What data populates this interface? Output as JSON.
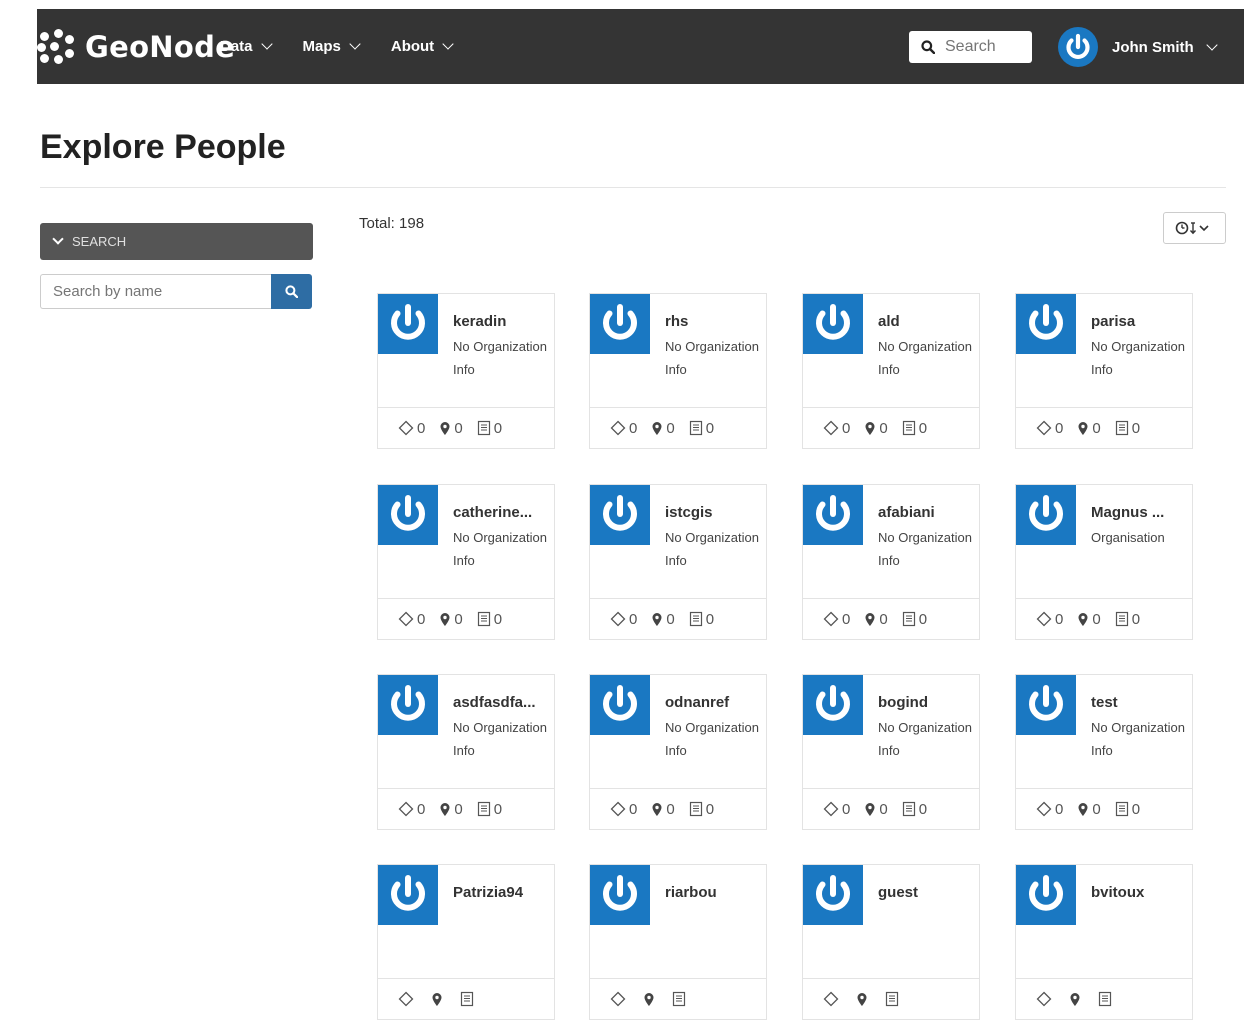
{
  "navbar": {
    "brand": "GeoNode",
    "menu": [
      {
        "label": "Data"
      },
      {
        "label": "Maps"
      },
      {
        "label": "About"
      }
    ],
    "search_placeholder": "Search",
    "user_name": "John Smith"
  },
  "page": {
    "title": "Explore People",
    "total_label": "Total: 198"
  },
  "sidebar": {
    "search_header": "SEARCH",
    "name_search_placeholder": "Search by name"
  },
  "colors": {
    "navbar_bg": "#343434",
    "accent": "#1a78c2",
    "search_button": "#2e6da4"
  },
  "people": [
    {
      "name": "keradin",
      "org": "No Organization Info",
      "layers": "0",
      "maps": "0",
      "docs": "0"
    },
    {
      "name": "rhs",
      "org": "No Organization Info",
      "layers": "0",
      "maps": "0",
      "docs": "0"
    },
    {
      "name": "ald",
      "org": "No Organization Info",
      "layers": "0",
      "maps": "0",
      "docs": "0"
    },
    {
      "name": "parisa",
      "org": "No Organization Info",
      "layers": "0",
      "maps": "0",
      "docs": "0"
    },
    {
      "name": "catherine...",
      "org": "No Organization Info",
      "layers": "0",
      "maps": "0",
      "docs": "0"
    },
    {
      "name": "istcgis",
      "org": "No Organization Info",
      "layers": "0",
      "maps": "0",
      "docs": "0"
    },
    {
      "name": "afabiani",
      "org": "No Organization Info",
      "layers": "0",
      "maps": "0",
      "docs": "0"
    },
    {
      "name": "Magnus ...",
      "org": "Organisation",
      "layers": "0",
      "maps": "0",
      "docs": "0"
    },
    {
      "name": "asdfasdfa...",
      "org": "No Organization Info",
      "layers": "0",
      "maps": "0",
      "docs": "0"
    },
    {
      "name": "odnanref",
      "org": "No Organization Info",
      "layers": "0",
      "maps": "0",
      "docs": "0"
    },
    {
      "name": "bogind",
      "org": "No Organization Info",
      "layers": "0",
      "maps": "0",
      "docs": "0"
    },
    {
      "name": "test",
      "org": "No Organization Info",
      "layers": "0",
      "maps": "0",
      "docs": "0"
    },
    {
      "name": "Patrizia94",
      "org": "",
      "layers": "",
      "maps": "",
      "docs": ""
    },
    {
      "name": "riarbou",
      "org": "",
      "layers": "",
      "maps": "",
      "docs": ""
    },
    {
      "name": "guest",
      "org": "",
      "layers": "",
      "maps": "",
      "docs": ""
    },
    {
      "name": "bvitoux",
      "org": "",
      "layers": "",
      "maps": "",
      "docs": ""
    }
  ],
  "icons": {
    "layers": "diamond-outline-icon",
    "maps": "map-marker-icon",
    "docs": "document-icon",
    "sort": "clock-sort-icon"
  }
}
